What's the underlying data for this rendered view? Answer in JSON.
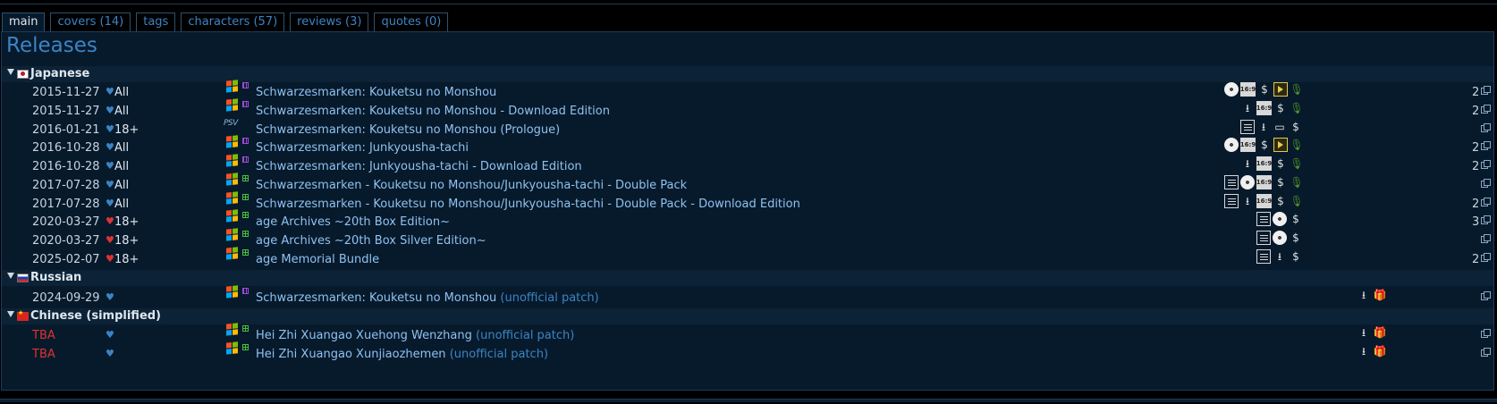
{
  "tabs": [
    {
      "label": "main",
      "active": true
    },
    {
      "label": "covers (14)"
    },
    {
      "label": "tags"
    },
    {
      "label": "characters (57)"
    },
    {
      "label": "reviews (3)"
    },
    {
      "label": "quotes (0)"
    }
  ],
  "heading": "Releases",
  "groups": [
    {
      "label": "Japanese",
      "flag": "jp-flag-icon"
    },
    {
      "label": "Russian",
      "flag": "ru-flag-icon"
    },
    {
      "label": "Chinese (simplified)",
      "flag": "cn-flag-icon"
    }
  ],
  "releases": [
    {
      "date": "2015-11-27",
      "age": "All",
      "title": "Schwarzesmarken: Kouketsu no Monshou",
      "count": "2",
      "icons": [
        "disc-icon",
        "16:9-icon",
        "money-icon",
        "video-icon",
        "mic-icon"
      ]
    },
    {
      "date": "2015-11-27",
      "age": "All",
      "title": "Schwarzesmarken: Kouketsu no Monshou - Download Edition",
      "count": "2",
      "icons": [
        "download-icon",
        "16:9-icon",
        "money-icon",
        "mic-icon"
      ]
    },
    {
      "date": "2016-01-21",
      "age": "18+",
      "platform_label": "PSV",
      "title": "Schwarzesmarken: Kouketsu no Monshou (Prologue)",
      "count": "",
      "icons": [
        "document-icon",
        "download-icon",
        "monitor-icon",
        "money-icon"
      ]
    },
    {
      "date": "2016-10-28",
      "age": "All",
      "title": "Schwarzesmarken: Junkyousha-tachi",
      "count": "2",
      "icons": [
        "disc-icon",
        "16:9-icon",
        "money-icon",
        "video-icon",
        "mic-icon"
      ]
    },
    {
      "date": "2016-10-28",
      "age": "All",
      "title": "Schwarzesmarken: Junkyousha-tachi - Download Edition",
      "count": "2",
      "icons": [
        "download-icon",
        "16:9-icon",
        "money-icon",
        "mic-icon"
      ]
    },
    {
      "date": "2017-07-28",
      "age": "All",
      "title": "Schwarzesmarken - Kouketsu no Monshou/Junkyousha-tachi - Double Pack",
      "count": "",
      "icons": [
        "document-icon",
        "disc-icon",
        "16:9-icon",
        "money-icon",
        "mic-icon"
      ]
    },
    {
      "date": "2017-07-28",
      "age": "All",
      "title": "Schwarzesmarken - Kouketsu no Monshou/Junkyousha-tachi - Double Pack - Download Edition",
      "count": "2",
      "icons": [
        "document-icon",
        "download-icon",
        "16:9-icon",
        "money-icon",
        "mic-icon"
      ]
    },
    {
      "date": "2020-03-27",
      "age": "18+",
      "title": "age Archives ~20th Box Edition~",
      "count": "3",
      "icons": [
        "document-icon",
        "disc-icon",
        "money-icon"
      ]
    },
    {
      "date": "2020-03-27",
      "age": "18+",
      "title": "age Archives ~20th Box Silver Edition~",
      "count": "",
      "icons": [
        "document-icon",
        "disc-icon",
        "money-icon"
      ]
    },
    {
      "date": "2025-02-07",
      "age": "18+",
      "title": "age Memorial Bundle",
      "count": "2",
      "icons": [
        "document-icon",
        "download-icon",
        "money-icon"
      ]
    },
    {
      "date": "2024-09-29",
      "age": "",
      "title": "Schwarzesmarken: Kouketsu no Monshou",
      "note": "(unofficial patch)",
      "count": "",
      "icons": [
        "download-icon",
        "gift-icon"
      ]
    },
    {
      "date": "TBA",
      "age": "",
      "title": "Hei Zhi Xuangao Xuehong Wenzhang",
      "note": "(unofficial patch)",
      "count": "",
      "icons": [
        "download-icon",
        "gift-icon"
      ]
    },
    {
      "date": "TBA",
      "age": "",
      "title": "Hei Zhi Xuangao Xunjiaozhemen",
      "note": "(unofficial patch)",
      "count": "",
      "icons": [
        "download-icon",
        "gift-icon"
      ]
    }
  ],
  "icon_labels": {
    "wide": "16:9",
    "money": "$",
    "download": "⭳",
    "gift": "🎁",
    "mic": "🎙",
    "monitor": "▭"
  },
  "colors": {
    "accent": "#3c84c5",
    "background": "#071a2b",
    "tba": "#dd3333"
  }
}
